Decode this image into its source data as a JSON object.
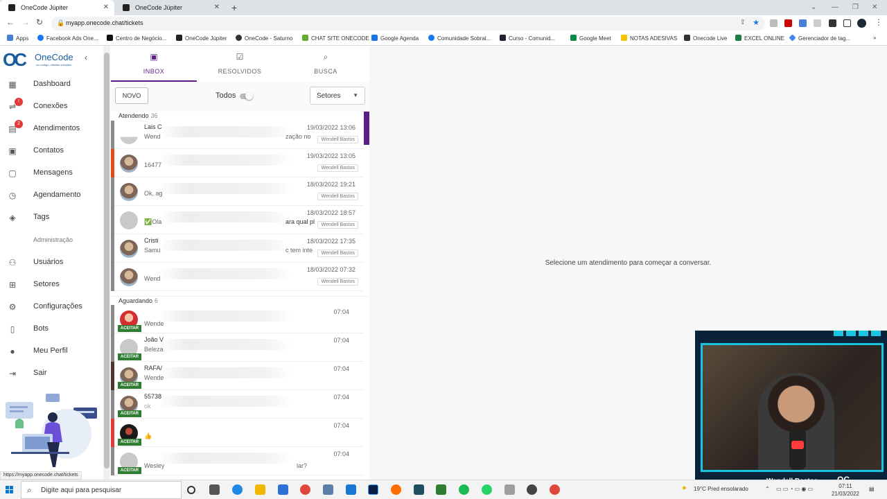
{
  "browser": {
    "tabs": [
      {
        "label": "OneCode Júpiter",
        "active": true
      },
      {
        "label": "OneCode Júpiter",
        "active": false
      }
    ],
    "url": "myapp.onecode.chat/tickets",
    "bookmarks": [
      "Apps",
      "Facebook Ads One...",
      "Centro de Negócio...",
      "OneCode Júpiter",
      "OneCode - Saturno",
      "CHAT SITE ONECODE",
      "Google Agenda",
      "Comunidade Sobral...",
      "Curso - Comunid...",
      "Google Meet",
      "NOTAS ADESIVAS",
      "Onecode Live",
      "EXCEL ONLINE",
      "Gerenciador de tag..."
    ],
    "status_url": "https://myapp.onecode.chat/tickets"
  },
  "sidebar": {
    "logo_name": "OneCode",
    "logo_mark": "OC",
    "logo_tagline": "um código, infinitas soluções",
    "items": [
      {
        "label": "Dashboard",
        "icon": "dashboard-icon"
      },
      {
        "label": "Conexões",
        "icon": "sync-icon",
        "badge": "!"
      },
      {
        "label": "Atendimentos",
        "icon": "chat-icon",
        "badge": "2"
      },
      {
        "label": "Contatos",
        "icon": "contacts-icon"
      },
      {
        "label": "Mensagens",
        "icon": "messages-icon"
      },
      {
        "label": "Agendamento",
        "icon": "clock-icon"
      },
      {
        "label": "Tags",
        "icon": "tag-icon"
      }
    ],
    "admin_header": "Administração",
    "admin_items": [
      {
        "label": "Usuários",
        "icon": "people-icon"
      },
      {
        "label": "Setores",
        "icon": "tree-icon"
      },
      {
        "label": "Configurações",
        "icon": "settings-icon"
      },
      {
        "label": "Bots",
        "icon": "bot-icon"
      },
      {
        "label": "Meu Perfil",
        "icon": "account-icon"
      },
      {
        "label": "Sair",
        "icon": "logout-icon"
      }
    ]
  },
  "tickets": {
    "tabs": [
      {
        "label": "INBOX",
        "icon": "inbox-icon",
        "active": true
      },
      {
        "label": "RESOLVIDOS",
        "icon": "check-box-icon",
        "active": false
      },
      {
        "label": "BUSCA",
        "icon": "search-icon",
        "active": false
      }
    ],
    "new_button": "NOVO",
    "todos_label": "Todos",
    "setores_label": "Setores",
    "open_section": {
      "title": "Atendendo",
      "count": "36"
    },
    "open_rows": [
      {
        "name": "Lais C",
        "msg": "Wend",
        "msg_tail": "zação no",
        "time": "19/03/2022 13:06",
        "tag": "Wendell Bastos"
      },
      {
        "name": "",
        "msg": "16477",
        "msg_tail": "",
        "time": "19/03/2022 13:05",
        "tag": "Wendell Bastos"
      },
      {
        "name": "",
        "msg": "Ok, ag",
        "msg_tail": "",
        "time": "18/03/2022 19:21",
        "tag": "Wendell Bastos"
      },
      {
        "name": "",
        "msg": "✅Ola",
        "msg_tail": "ara qual pl",
        "time": "18/03/2022 18:57",
        "tag": "Wendell Bastos"
      },
      {
        "name": "Cristi",
        "msg": "Samu",
        "msg_tail": "c tem inte",
        "time": "18/03/2022 17:35",
        "tag": "Wendell Bastos"
      },
      {
        "name": "",
        "msg": "Wend",
        "msg_tail": "",
        "time": "18/03/2022 07:32",
        "tag": "Wendell Bastos"
      }
    ],
    "pending_section": {
      "title": "Aguardando",
      "count": "6"
    },
    "pending_rows": [
      {
        "name": "",
        "msg": "Wende",
        "time": "07:04",
        "accept": "ACEITAR"
      },
      {
        "name": "João V",
        "msg": "Beleza",
        "time": "07:04",
        "accept": "ACEITAR"
      },
      {
        "name": "RAFA/",
        "msg": "Wende",
        "time": "07:04",
        "accept": "ACEITAR"
      },
      {
        "name": "55738",
        "msg": "ok",
        "time": "07:04",
        "accept": "ACEITAR"
      },
      {
        "name": "",
        "msg": "👍",
        "time": "07:04",
        "accept": "ACEITAR"
      },
      {
        "name": "",
        "msg": "Wesley",
        "msg_tail": "lar?",
        "time": "07:04",
        "accept": "ACEITAR"
      }
    ]
  },
  "main": {
    "empty_message": "Selecione um atendimento para começar a conversar."
  },
  "webcam": {
    "name": "Wendell Bastos",
    "logo": "OC"
  },
  "taskbar": {
    "search_placeholder": "Digite aqui para pesquisar",
    "weather": "19°C  Pred ensolarado",
    "time": "07:11",
    "date": "21/03/2022"
  },
  "colors": {
    "accent": "#5a1d86",
    "accept_green": "#2e7d32",
    "brand_blue": "#1b5e9e",
    "cam_border": "#19c4e0"
  }
}
